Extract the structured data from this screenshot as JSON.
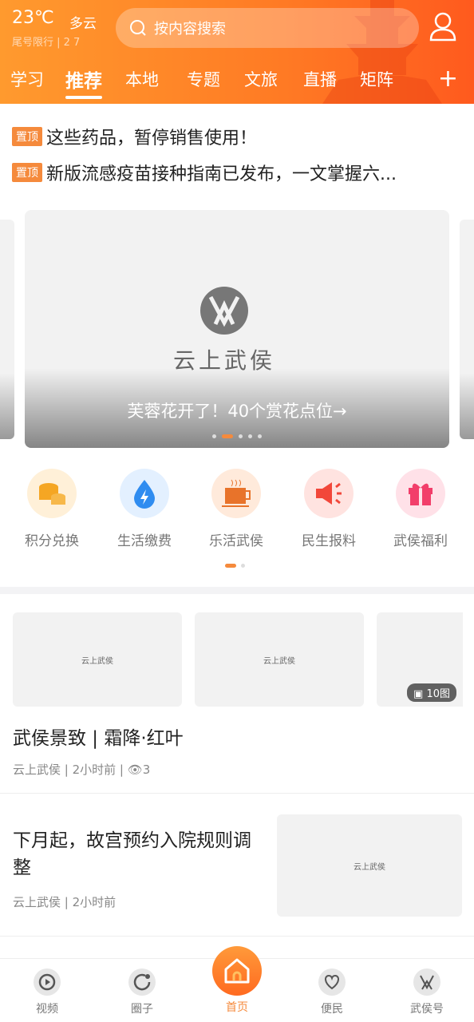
{
  "header": {
    "temperature": "23℃",
    "weather": "多云",
    "plate_limit": "尾号限行 | 2 7",
    "search_placeholder": "按内容搜索"
  },
  "tabs": [
    {
      "label": "学习"
    },
    {
      "label": "推荐",
      "active": true
    },
    {
      "label": "本地"
    },
    {
      "label": "专题"
    },
    {
      "label": "文旅"
    },
    {
      "label": "直播"
    },
    {
      "label": "矩阵"
    }
  ],
  "pinned": {
    "badge": "置顶",
    "items": [
      "这些药品，暂停销售使用！",
      "新版流感疫苗接种指南已发布，一文掌握六..."
    ]
  },
  "banner": {
    "logo_text": "云上武侯",
    "caption": "芙蓉花开了！40个赏花点位→",
    "slide_count": 5,
    "active_slide": 2
  },
  "services": [
    {
      "label": "积分兑换",
      "icon": "coins-icon"
    },
    {
      "label": "生活缴费",
      "icon": "water-bolt-icon"
    },
    {
      "label": "乐活武侯",
      "icon": "coffee-icon"
    },
    {
      "label": "民生报料",
      "icon": "speaker-icon"
    },
    {
      "label": "武侯福利",
      "icon": "gift-icon"
    }
  ],
  "articles": [
    {
      "title": "武侯景致 | 霜降·红叶",
      "meta": "云上武侯 | 2小时前 | ",
      "views": "3",
      "image_count": "10图",
      "thumb_logo": "云上武侯"
    },
    {
      "title": "下月起，故宫预约入院规则调整",
      "meta": "云上武侯 | 2小时前",
      "thumb_logo": "云上武侯"
    }
  ],
  "bottom_nav": [
    {
      "label": "视频"
    },
    {
      "label": "圈子"
    },
    {
      "label": "首页",
      "active": true
    },
    {
      "label": "便民"
    },
    {
      "label": "武侯号"
    }
  ],
  "colors": {
    "accent": "#f58a3c",
    "header": "#ff8a2a"
  }
}
